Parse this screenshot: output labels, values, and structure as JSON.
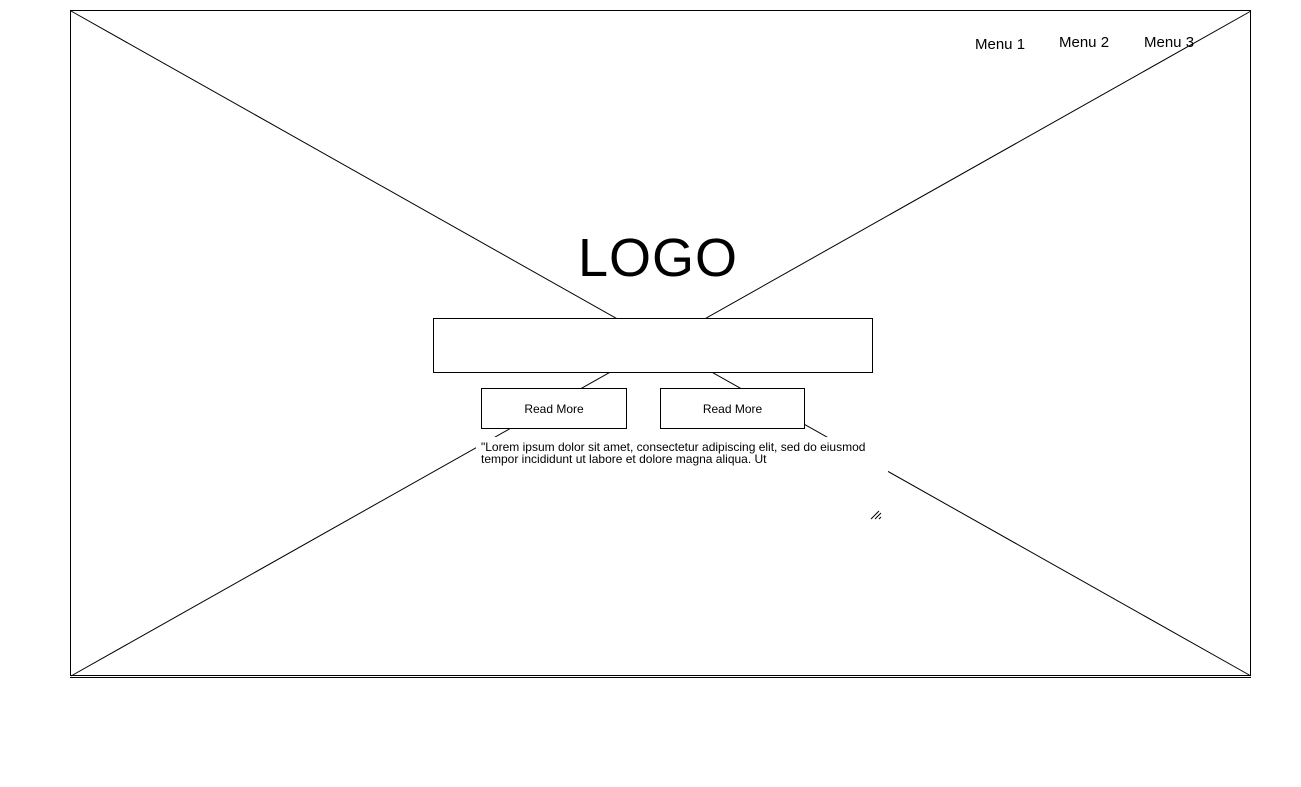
{
  "nav": {
    "items": [
      "Menu 1",
      "Menu 2",
      "Menu 3"
    ]
  },
  "hero": {
    "logo": "LOGO",
    "buttons": [
      "Read More",
      "Read More"
    ],
    "body_text": "\"Lorem ipsum dolor sit amet, consectetur adipiscing elit, sed do eiusmod tempor incididunt ut labore et dolore magna aliqua. Ut"
  }
}
